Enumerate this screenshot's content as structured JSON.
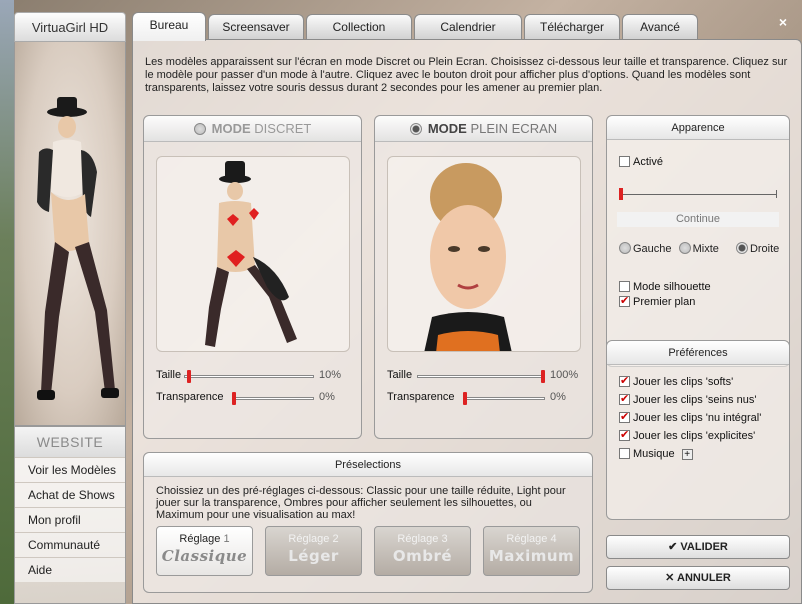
{
  "app": {
    "title": "VirtuaGirl HD",
    "close": "×"
  },
  "tabs": [
    {
      "label": "Bureau",
      "active": true
    },
    {
      "label": "Screensaver"
    },
    {
      "label": "Collection"
    },
    {
      "label": "Calendrier"
    },
    {
      "label": "Télécharger"
    },
    {
      "label": "Avancé"
    }
  ],
  "intro": "Les modèles apparaissent sur l'écran en mode Discret ou Plein Ecran. Choisissez ci-dessous leur taille et transparence. Cliquez sur le modèle pour passer d'un mode à l'autre. Cliquez avec le bouton droit pour afficher plus d'options. Quand les modèles sont transparents, laissez votre souris dessus durant 2 secondes pour les amener au premier plan.",
  "discret": {
    "mode_word": "MODE",
    "mode_name": "DISCRET",
    "selected": false,
    "size_label": "Taille",
    "size_value": "10%",
    "size_level": 0.02,
    "transp_label": "Transparence",
    "transp_value": "0%",
    "transp_level": 0.0
  },
  "plein": {
    "mode_word": "MODE",
    "mode_name": "PLEIN ECRAN",
    "selected": true,
    "size_label": "Taille",
    "size_value": "100%",
    "size_level": 1.0,
    "transp_label": "Transparence",
    "transp_value": "0%",
    "transp_level": 0.0
  },
  "apparence": {
    "title": "Apparence",
    "active_label": "Activé",
    "active_checked": false,
    "level": 0.0,
    "continue_label": "Continue",
    "align": {
      "left": "Gauche",
      "mid": "Mixte",
      "right": "Droite",
      "selected": "Droite"
    },
    "silhouette_label": "Mode silhouette",
    "silhouette_checked": false,
    "front_label": "Premier plan",
    "front_checked": true
  },
  "preferences": {
    "title": "Préférences",
    "items": [
      {
        "label": "Jouer les clips 'softs'",
        "checked": true
      },
      {
        "label": "Jouer les clips 'seins nus'",
        "checked": true
      },
      {
        "label": "Jouer les clips 'nu intégral'",
        "checked": true
      },
      {
        "label": "Jouer les clips 'explicites'",
        "checked": true
      },
      {
        "label": "Musique",
        "checked": false
      }
    ],
    "music_plus": "+"
  },
  "presets": {
    "title": "Préselections",
    "desc": "Choissiez un des pré-réglages ci-dessous: Classic pour une taille réduite, Light pour jouer sur la transparence, Ombres pour afficher seulement les silhouettes, ou Maximum pour une visualisation au max!",
    "items": [
      {
        "word": "Réglage",
        "num": "1",
        "name": "Classique",
        "selected": true
      },
      {
        "word": "Réglage",
        "num": "2",
        "name": "Léger"
      },
      {
        "word": "Réglage",
        "num": "3",
        "name": "Ombré"
      },
      {
        "word": "Réglage",
        "num": "4",
        "name": "Maximum"
      }
    ]
  },
  "website": {
    "title": "WEBSITE",
    "links": [
      "Voir les Modèles",
      "Achat de Shows",
      "Mon profil",
      "Communauté",
      "Aide"
    ]
  },
  "actions": {
    "ok_icon": "✔",
    "ok": "VALIDER",
    "cancel_icon": "✕",
    "cancel": "ANNULER"
  },
  "colors": {
    "accent": "#dd2222",
    "panel": "#f6f0ec"
  }
}
